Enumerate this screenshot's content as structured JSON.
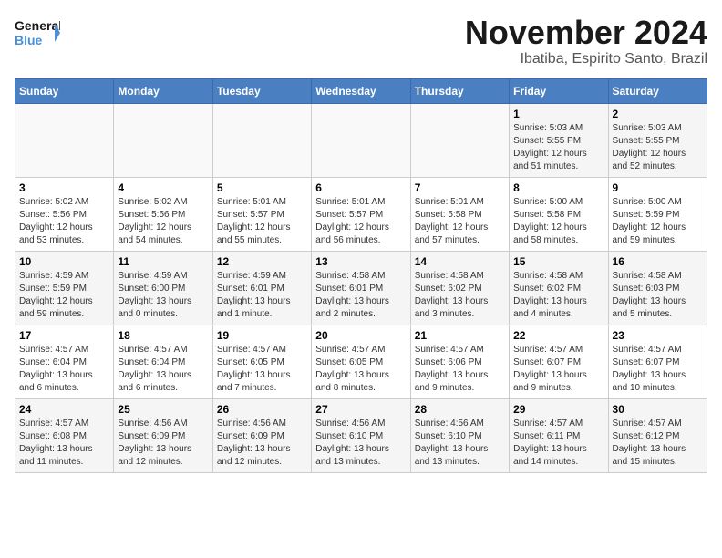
{
  "header": {
    "logo_line1": "General",
    "logo_line2": "Blue",
    "month_title": "November 2024",
    "location": "Ibatiba, Espirito Santo, Brazil"
  },
  "weekdays": [
    "Sunday",
    "Monday",
    "Tuesday",
    "Wednesday",
    "Thursday",
    "Friday",
    "Saturday"
  ],
  "weeks": [
    [
      {
        "day": "",
        "info": ""
      },
      {
        "day": "",
        "info": ""
      },
      {
        "day": "",
        "info": ""
      },
      {
        "day": "",
        "info": ""
      },
      {
        "day": "",
        "info": ""
      },
      {
        "day": "1",
        "info": "Sunrise: 5:03 AM\nSunset: 5:55 PM\nDaylight: 12 hours\nand 51 minutes."
      },
      {
        "day": "2",
        "info": "Sunrise: 5:03 AM\nSunset: 5:55 PM\nDaylight: 12 hours\nand 52 minutes."
      }
    ],
    [
      {
        "day": "3",
        "info": "Sunrise: 5:02 AM\nSunset: 5:56 PM\nDaylight: 12 hours\nand 53 minutes."
      },
      {
        "day": "4",
        "info": "Sunrise: 5:02 AM\nSunset: 5:56 PM\nDaylight: 12 hours\nand 54 minutes."
      },
      {
        "day": "5",
        "info": "Sunrise: 5:01 AM\nSunset: 5:57 PM\nDaylight: 12 hours\nand 55 minutes."
      },
      {
        "day": "6",
        "info": "Sunrise: 5:01 AM\nSunset: 5:57 PM\nDaylight: 12 hours\nand 56 minutes."
      },
      {
        "day": "7",
        "info": "Sunrise: 5:01 AM\nSunset: 5:58 PM\nDaylight: 12 hours\nand 57 minutes."
      },
      {
        "day": "8",
        "info": "Sunrise: 5:00 AM\nSunset: 5:58 PM\nDaylight: 12 hours\nand 58 minutes."
      },
      {
        "day": "9",
        "info": "Sunrise: 5:00 AM\nSunset: 5:59 PM\nDaylight: 12 hours\nand 59 minutes."
      }
    ],
    [
      {
        "day": "10",
        "info": "Sunrise: 4:59 AM\nSunset: 5:59 PM\nDaylight: 12 hours\nand 59 minutes."
      },
      {
        "day": "11",
        "info": "Sunrise: 4:59 AM\nSunset: 6:00 PM\nDaylight: 13 hours\nand 0 minutes."
      },
      {
        "day": "12",
        "info": "Sunrise: 4:59 AM\nSunset: 6:01 PM\nDaylight: 13 hours\nand 1 minute."
      },
      {
        "day": "13",
        "info": "Sunrise: 4:58 AM\nSunset: 6:01 PM\nDaylight: 13 hours\nand 2 minutes."
      },
      {
        "day": "14",
        "info": "Sunrise: 4:58 AM\nSunset: 6:02 PM\nDaylight: 13 hours\nand 3 minutes."
      },
      {
        "day": "15",
        "info": "Sunrise: 4:58 AM\nSunset: 6:02 PM\nDaylight: 13 hours\nand 4 minutes."
      },
      {
        "day": "16",
        "info": "Sunrise: 4:58 AM\nSunset: 6:03 PM\nDaylight: 13 hours\nand 5 minutes."
      }
    ],
    [
      {
        "day": "17",
        "info": "Sunrise: 4:57 AM\nSunset: 6:04 PM\nDaylight: 13 hours\nand 6 minutes."
      },
      {
        "day": "18",
        "info": "Sunrise: 4:57 AM\nSunset: 6:04 PM\nDaylight: 13 hours\nand 6 minutes."
      },
      {
        "day": "19",
        "info": "Sunrise: 4:57 AM\nSunset: 6:05 PM\nDaylight: 13 hours\nand 7 minutes."
      },
      {
        "day": "20",
        "info": "Sunrise: 4:57 AM\nSunset: 6:05 PM\nDaylight: 13 hours\nand 8 minutes."
      },
      {
        "day": "21",
        "info": "Sunrise: 4:57 AM\nSunset: 6:06 PM\nDaylight: 13 hours\nand 9 minutes."
      },
      {
        "day": "22",
        "info": "Sunrise: 4:57 AM\nSunset: 6:07 PM\nDaylight: 13 hours\nand 9 minutes."
      },
      {
        "day": "23",
        "info": "Sunrise: 4:57 AM\nSunset: 6:07 PM\nDaylight: 13 hours\nand 10 minutes."
      }
    ],
    [
      {
        "day": "24",
        "info": "Sunrise: 4:57 AM\nSunset: 6:08 PM\nDaylight: 13 hours\nand 11 minutes."
      },
      {
        "day": "25",
        "info": "Sunrise: 4:56 AM\nSunset: 6:09 PM\nDaylight: 13 hours\nand 12 minutes."
      },
      {
        "day": "26",
        "info": "Sunrise: 4:56 AM\nSunset: 6:09 PM\nDaylight: 13 hours\nand 12 minutes."
      },
      {
        "day": "27",
        "info": "Sunrise: 4:56 AM\nSunset: 6:10 PM\nDaylight: 13 hours\nand 13 minutes."
      },
      {
        "day": "28",
        "info": "Sunrise: 4:56 AM\nSunset: 6:10 PM\nDaylight: 13 hours\nand 13 minutes."
      },
      {
        "day": "29",
        "info": "Sunrise: 4:57 AM\nSunset: 6:11 PM\nDaylight: 13 hours\nand 14 minutes."
      },
      {
        "day": "30",
        "info": "Sunrise: 4:57 AM\nSunset: 6:12 PM\nDaylight: 13 hours\nand 15 minutes."
      }
    ]
  ]
}
